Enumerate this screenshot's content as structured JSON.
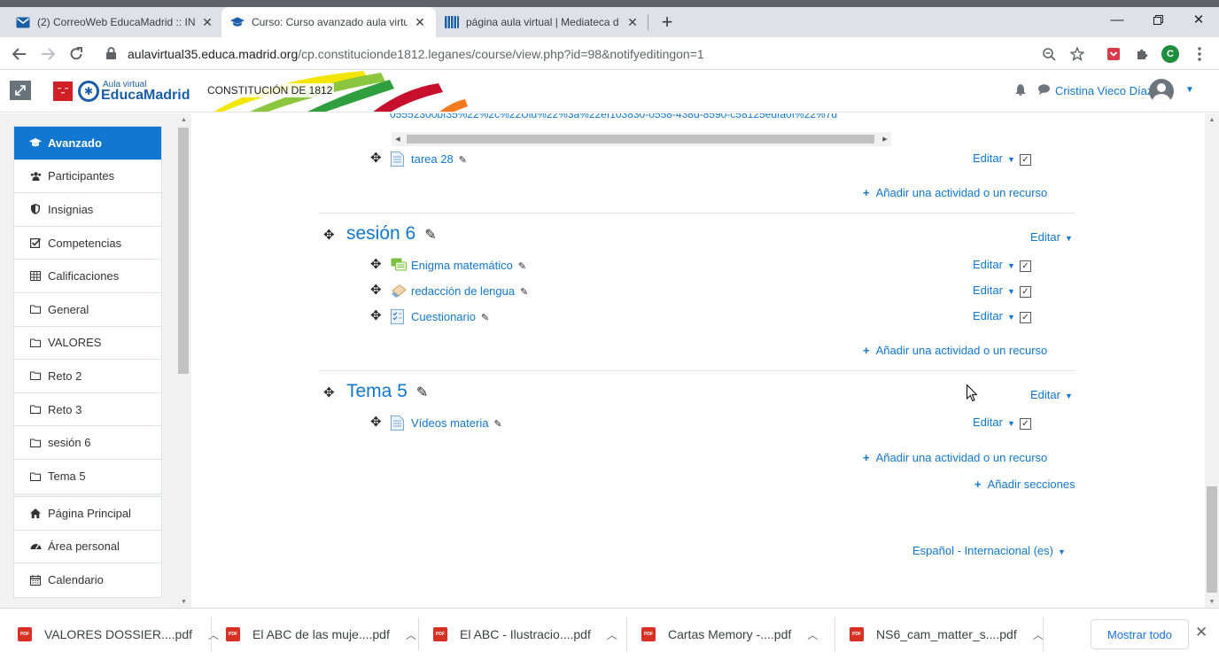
{
  "browser": {
    "tabs": [
      {
        "title": "(2) CorreoWeb EducaMadrid :: IN",
        "icon": "mail-icon"
      },
      {
        "title": "Curso: Curso avanzado aula virtu",
        "icon": "moodle-cap-icon"
      },
      {
        "title": "página aula virtual | Mediateca d",
        "icon": "mediateca-icon"
      }
    ],
    "url_host": "aulavirtual35.educa.madrid.org",
    "url_path": "/cp.constitucionde1812.leganes/course/view.php?id=98&notifyeditingon=1",
    "profile_initial": "C",
    "colors": {
      "accent": "#1a73e8",
      "profile": "#1e8e3e"
    }
  },
  "header": {
    "logo_small": "Aula virtual",
    "logo_big": "EducaMadrid",
    "logo_badge": "Comunidad de Madrid",
    "site_name": "CONSTITUCIÓN DE 1812",
    "user_name": "Cristina Vieco Díaz"
  },
  "nav": {
    "course_items": [
      {
        "label": "Avanzado",
        "icon": "graduation-cap-icon",
        "active": true
      },
      {
        "label": "Participantes",
        "icon": "users-icon"
      },
      {
        "label": "Insignias",
        "icon": "shield-icon"
      },
      {
        "label": "Competencias",
        "icon": "check-square-icon"
      },
      {
        "label": "Calificaciones",
        "icon": "table-icon"
      },
      {
        "label": "General",
        "icon": "folder-icon"
      },
      {
        "label": "VALORES",
        "icon": "folder-icon"
      },
      {
        "label": "Reto 2",
        "icon": "folder-icon"
      },
      {
        "label": "Reto 3",
        "icon": "folder-icon"
      },
      {
        "label": "sesión 6",
        "icon": "folder-icon"
      },
      {
        "label": "Tema 5",
        "icon": "folder-icon"
      }
    ],
    "site_items": [
      {
        "label": "Página Principal",
        "icon": "home-icon"
      },
      {
        "label": "Área personal",
        "icon": "dashboard-icon"
      },
      {
        "label": "Calendario",
        "icon": "calendar-icon"
      }
    ]
  },
  "content": {
    "cut_text": "05552300bf35%22%2c%22Uid%22%3a%22ef103830-0558-438d-8590-c58125edfa0f%22%7d",
    "edit_label": "Editar",
    "add_activity_label": "Añadir una actividad o un recurso",
    "add_sections_label": "Añadir secciones",
    "prev_section": {
      "activities": [
        {
          "name": "tarea 28",
          "icon": "file-icon"
        }
      ]
    },
    "sections": [
      {
        "title": "sesión 6",
        "activities": [
          {
            "name": "Enigma matemático",
            "icon": "forum-icon"
          },
          {
            "name": "redacción de lengua",
            "icon": "assignment-icon"
          },
          {
            "name": "Cuestionario",
            "icon": "quiz-icon"
          }
        ]
      },
      {
        "title": "Tema 5",
        "activities": [
          {
            "name": "Vídeos materia",
            "icon": "file-icon"
          }
        ]
      }
    ],
    "language": "Español - Internacional (es)",
    "colors": {
      "link": "#1177d1",
      "active_nav": "#1177d1"
    }
  },
  "downloads": {
    "items": [
      {
        "name": "VALORES DOSSIER....pdf"
      },
      {
        "name": "El ABC de las muje....pdf"
      },
      {
        "name": "El ABC - Ilustracio....pdf"
      },
      {
        "name": "Cartas Memory -....pdf"
      },
      {
        "name": "NS6_cam_matter_s....pdf"
      }
    ],
    "file_badge": "PDF",
    "show_all": "Mostrar todo"
  }
}
